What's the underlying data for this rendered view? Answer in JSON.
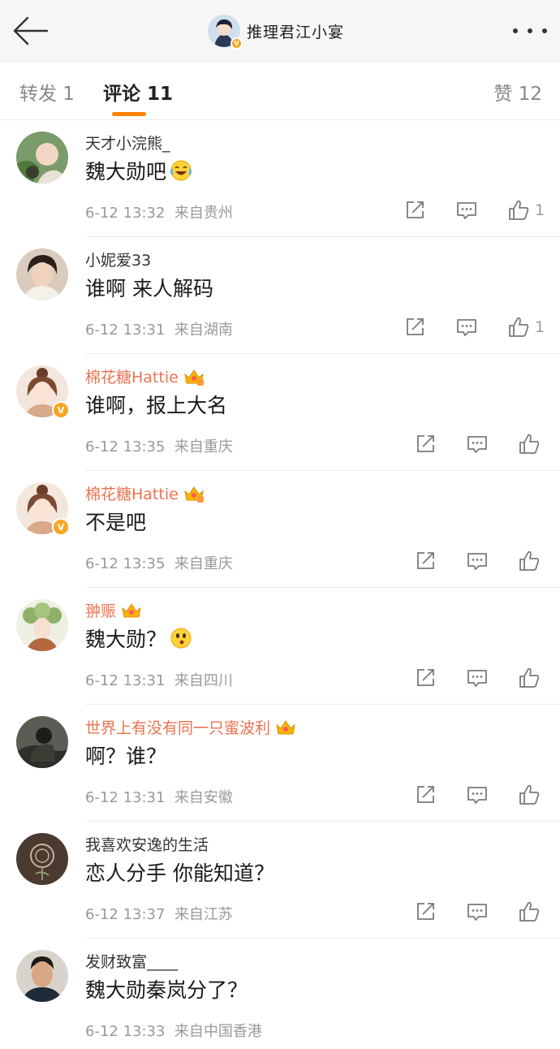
{
  "header": {
    "title": "推理君江小宴"
  },
  "tabs": {
    "repost": "转发 1",
    "comments": "评论 11",
    "likes": "赞 12"
  },
  "colors": {
    "accent": "#ff8200",
    "vip_name": "#eb7350",
    "meta": "#999999",
    "verified": "#f5a623"
  },
  "comments": [
    {
      "user": "天才小浣熊_",
      "text": "魏大勋吧",
      "emoji": "laughing-tears-emoji",
      "time": "6-12 13:32",
      "location": "来自贵州",
      "likes": "1"
    },
    {
      "user": "小妮爱33",
      "text": "谁啊 来人解码",
      "time": "6-12 13:31",
      "location": "来自湖南",
      "likes": "1"
    },
    {
      "user": "棉花糖Hattie",
      "text": "谁啊，报上大名",
      "time": "6-12 13:35",
      "location": "来自重庆",
      "likes": ""
    },
    {
      "user": "棉花糖Hattie",
      "text": "不是吧",
      "time": "6-12 13:35",
      "location": "来自重庆",
      "likes": ""
    },
    {
      "user": "翀赈",
      "text": "魏大勋？",
      "emoji": "smirk-emoji",
      "time": "6-12 13:31",
      "location": "来自四川",
      "likes": ""
    },
    {
      "user": "世界上有没有同一只蜜波利",
      "text": "啊？谁？",
      "time": "6-12 13:31",
      "location": "来自安徽",
      "likes": ""
    },
    {
      "user": "我喜欢安逸的生活",
      "text": "恋人分手 你能知道？",
      "time": "6-12 13:37",
      "location": "来自江苏",
      "likes": ""
    },
    {
      "user": "发财致富____",
      "text": "魏大勋秦岚分了？",
      "time": "6-12 13:33",
      "location": "来自中国香港",
      "likes": ""
    }
  ]
}
